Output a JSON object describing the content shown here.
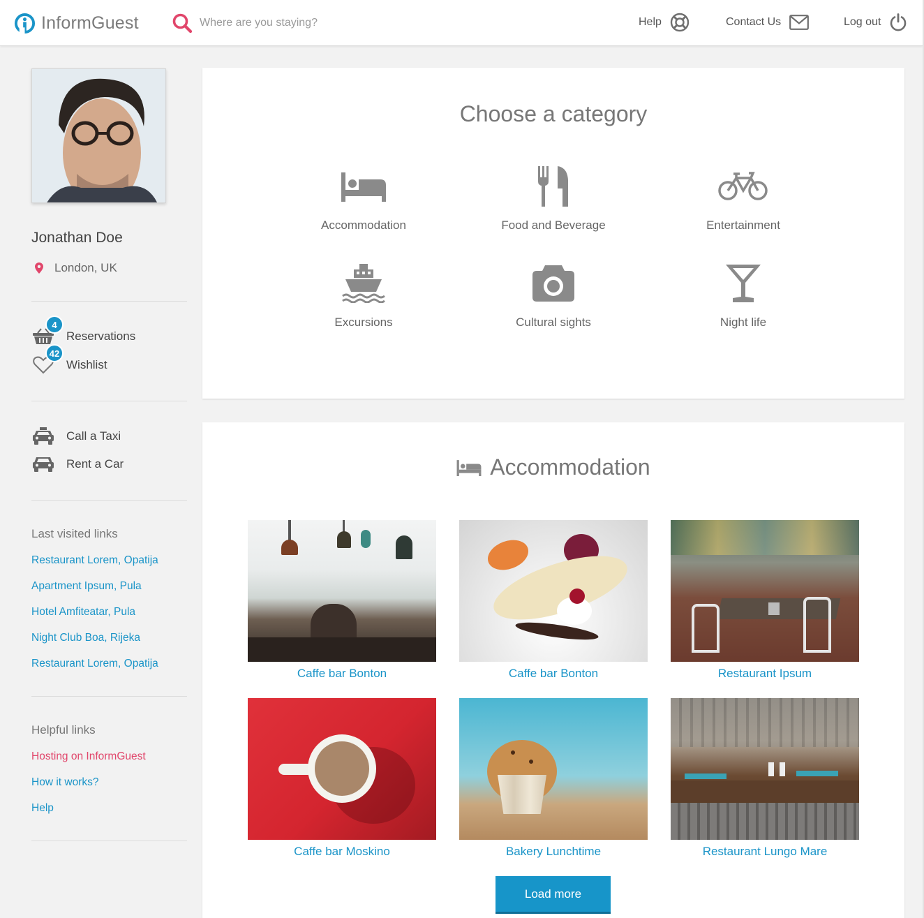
{
  "header": {
    "brand": "InformGuest",
    "search_placeholder": "Where are you staying?",
    "nav": [
      {
        "label": "Help",
        "icon": "lifebuoy-icon"
      },
      {
        "label": "Contact Us",
        "icon": "envelope-icon"
      },
      {
        "label": "Log out",
        "icon": "power-icon"
      }
    ]
  },
  "sidebar": {
    "user": {
      "name": "Jonathan Doe",
      "location": "London, UK"
    },
    "counters": [
      {
        "label": "Reservations",
        "count": "4",
        "icon": "basket-icon"
      },
      {
        "label": "Wishlist",
        "count": "42",
        "icon": "heart-icon"
      }
    ],
    "transport": [
      {
        "label": "Call a Taxi",
        "icon": "taxi-icon"
      },
      {
        "label": "Rent a Car",
        "icon": "car-icon"
      }
    ],
    "last_visited": {
      "heading": "Last visited links",
      "links": [
        "Restaurant Lorem, Opatija",
        "Apartment Ipsum, Pula",
        "Hotel Amfiteatar, Pula",
        "Night Club Boa, Rijeka",
        "Restaurant Lorem, Opatija"
      ]
    },
    "helpful": {
      "heading": "Helpful links",
      "links": [
        "Hosting on InformGuest",
        "How it works?",
        "Help"
      ]
    }
  },
  "categories": {
    "title": "Choose a category",
    "items": [
      {
        "label": "Accommodation",
        "icon": "bed-icon"
      },
      {
        "label": "Food and Beverage",
        "icon": "fork-knife-icon"
      },
      {
        "label": "Entertainment",
        "icon": "bicycle-icon"
      },
      {
        "label": "Excursions",
        "icon": "ship-icon"
      },
      {
        "label": "Cultural sights",
        "icon": "camera-icon"
      },
      {
        "label": "Night life",
        "icon": "cocktail-icon"
      }
    ]
  },
  "accommodation": {
    "title": "Accommodation",
    "cards": [
      {
        "name": "Caffe bar Bonton"
      },
      {
        "name": "Caffe bar Bonton"
      },
      {
        "name": "Restaurant Ipsum"
      },
      {
        "name": "Caffe bar Moskino"
      },
      {
        "name": "Bakery Lunchtime"
      },
      {
        "name": "Restaurant Lungo Mare"
      }
    ],
    "load_more": "Load more"
  },
  "colors": {
    "accent": "#1a94c8",
    "pink": "#e1466b",
    "icon_gray": "#8a8a8a"
  }
}
